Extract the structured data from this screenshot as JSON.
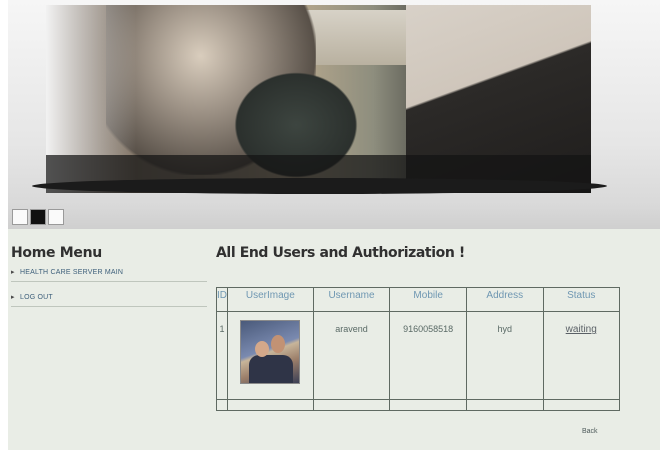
{
  "sidebar": {
    "title": "Home Menu",
    "items": [
      {
        "label": "HEALTH CARE SERVER MAIN"
      },
      {
        "label": "LOG OUT"
      }
    ]
  },
  "main": {
    "title": "All End Users and Authorization !",
    "table": {
      "headers": [
        "ID",
        "UserImage",
        "Username",
        "Mobile",
        "Address",
        "Status"
      ],
      "rows": [
        {
          "id": "1",
          "username": "aravend",
          "mobile": "9160058518",
          "address": "hyd",
          "status": "waiting"
        }
      ]
    }
  },
  "slider": {
    "active_index": 1
  },
  "footer": {
    "back_label": "Back"
  }
}
